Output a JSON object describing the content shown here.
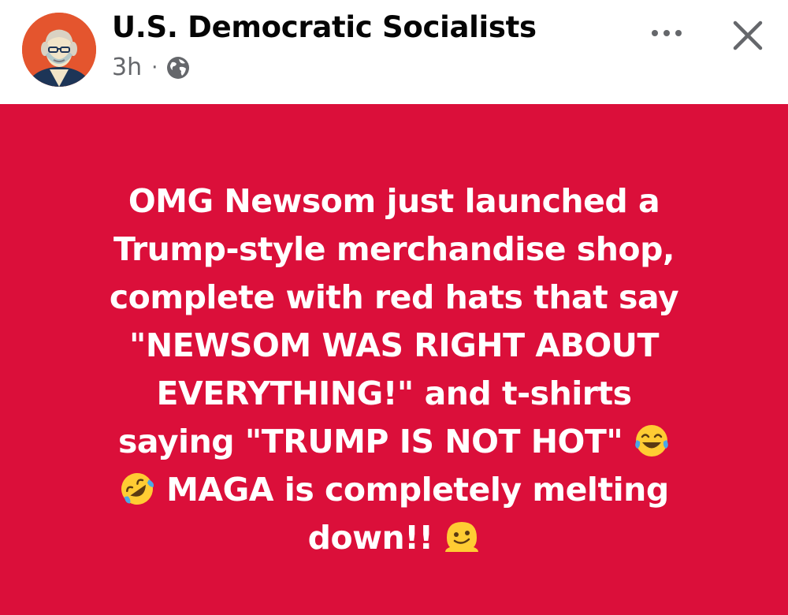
{
  "header": {
    "page_name": "U.S. Democratic Socialists",
    "timestamp": "3h",
    "separator": "·",
    "privacy_icon": "globe-icon",
    "more_icon": "ellipsis-icon",
    "close_icon": "close-icon"
  },
  "post": {
    "background_color": "#db0f3a",
    "text_color": "#ffffff",
    "lines": [
      "OMG Newsom just launched a",
      "Trump-style merchandise shop,",
      "complete with red hats that say",
      "\"NEWSOM WAS RIGHT ABOUT",
      "EVERYTHING!\" and t-shirts",
      "saying \"TRUMP IS NOT HOT\"",
      "MAGA is completely melting",
      "down!!"
    ],
    "emojis": [
      "face-with-tears-of-joy",
      "rolling-on-floor-laughing",
      "melting-face"
    ]
  }
}
